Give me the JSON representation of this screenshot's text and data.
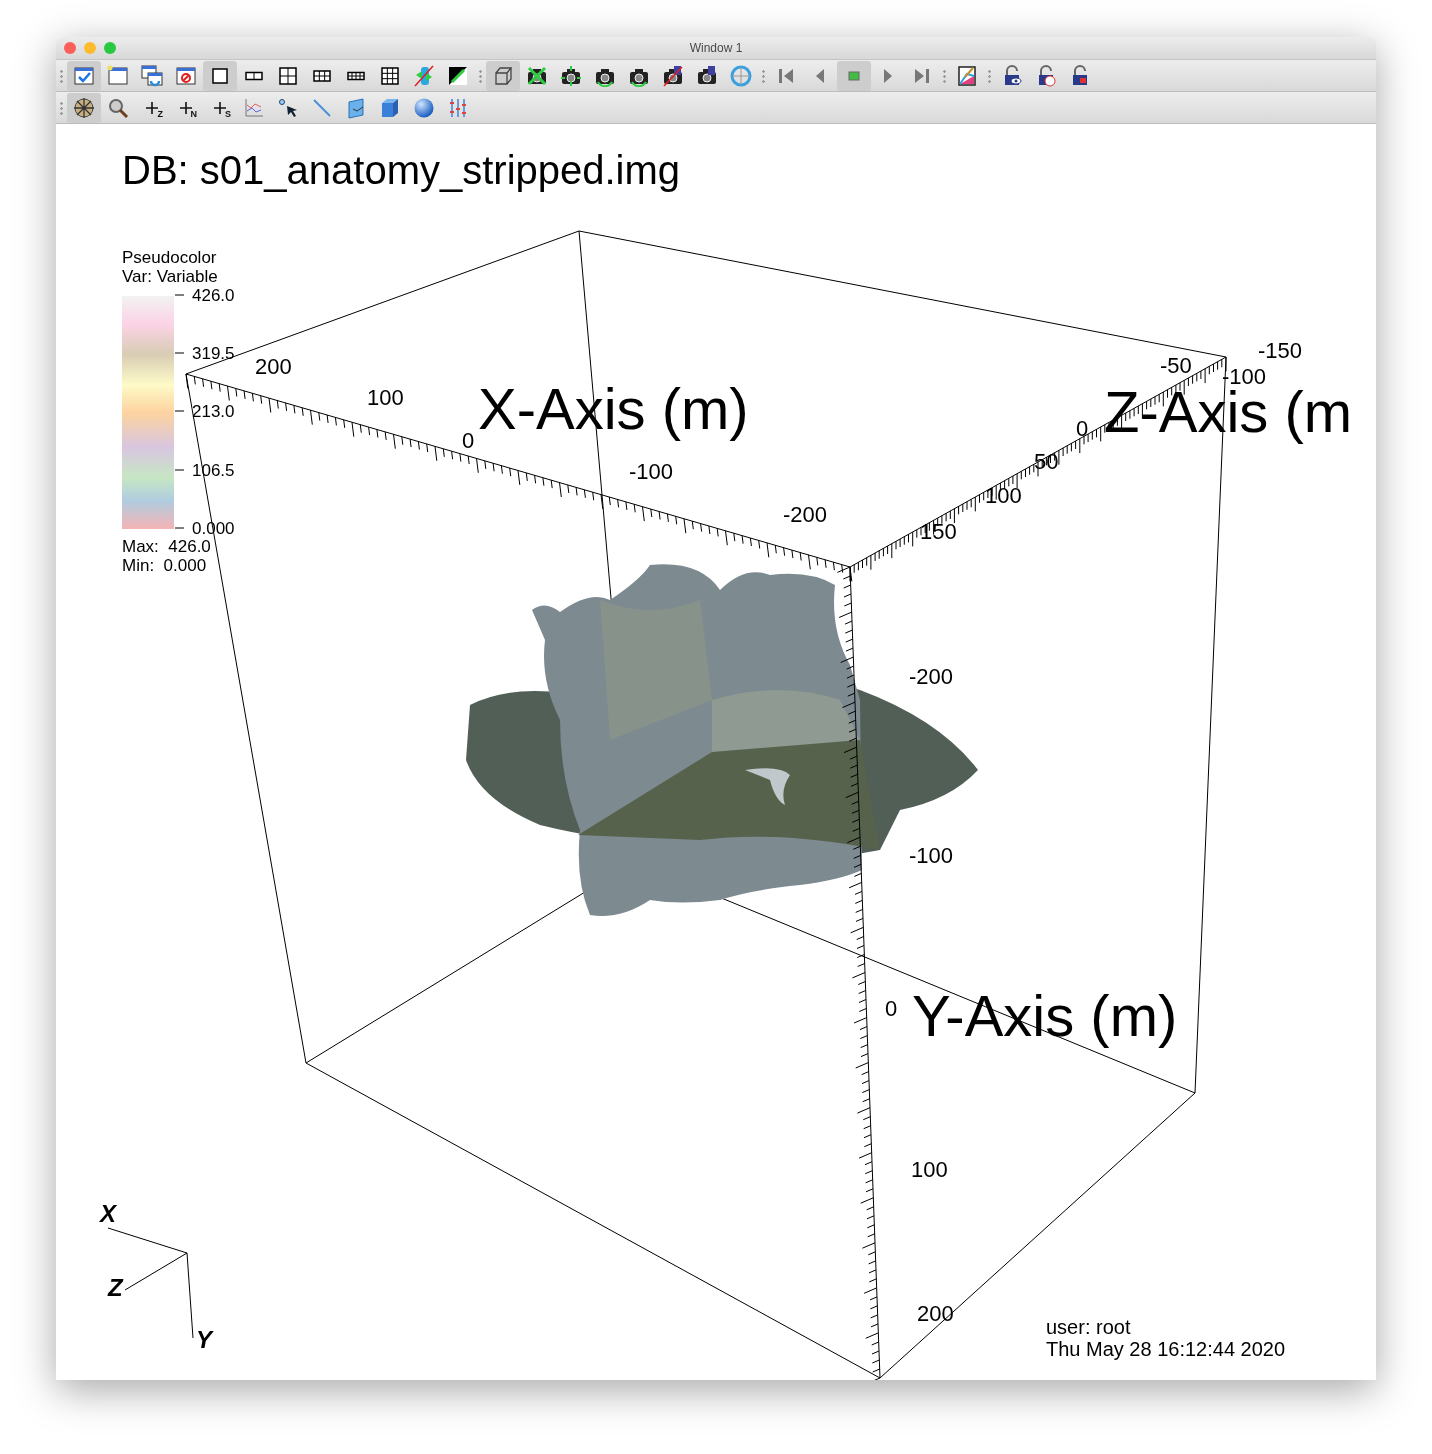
{
  "window": {
    "title": "Window 1"
  },
  "toolbar_1": {
    "groups": [
      {
        "buttons": [
          {
            "kind": "window-check",
            "selected": true
          },
          {
            "kind": "window-new",
            "selected": false
          },
          {
            "kind": "window-clone",
            "selected": false
          },
          {
            "kind": "window-delete",
            "selected": false
          },
          {
            "kind": "layout-1",
            "selected": true
          },
          {
            "kind": "layout-2",
            "selected": false
          },
          {
            "kind": "layout-4",
            "selected": false
          },
          {
            "kind": "layout-6",
            "selected": false
          },
          {
            "kind": "layout-8",
            "selected": false
          },
          {
            "kind": "layout-9",
            "selected": false
          },
          {
            "kind": "tool-crossed",
            "selected": false
          },
          {
            "kind": "invert",
            "selected": false
          }
        ]
      },
      {
        "buttons": [
          {
            "kind": "box-3d",
            "selected": true
          },
          {
            "kind": "camera-x",
            "selected": false
          },
          {
            "kind": "camera-move",
            "selected": false
          },
          {
            "kind": "camera-rotate",
            "selected": false
          },
          {
            "kind": "camera-rotate",
            "selected": false
          },
          {
            "kind": "camera-crossed",
            "selected": false
          },
          {
            "kind": "camera-save",
            "selected": false
          },
          {
            "kind": "globe",
            "selected": false
          }
        ]
      },
      {
        "buttons": [
          {
            "kind": "first",
            "selected": false
          },
          {
            "kind": "prev",
            "selected": false
          },
          {
            "kind": "stop",
            "selected": true
          },
          {
            "kind": "play",
            "selected": false
          },
          {
            "kind": "last",
            "selected": false
          }
        ]
      },
      {
        "buttons": [
          {
            "kind": "paint",
            "selected": false
          }
        ]
      },
      {
        "buttons": [
          {
            "kind": "lock-eye",
            "selected": false
          },
          {
            "kind": "lock-clock",
            "selected": false
          },
          {
            "kind": "lock-red",
            "selected": false
          }
        ]
      }
    ]
  },
  "toolbar_2": {
    "groups": [
      {
        "buttons": [
          {
            "kind": "compass",
            "selected": true
          },
          {
            "kind": "zoom",
            "selected": false
          },
          {
            "kind": "plus",
            "label": "Z",
            "selected": false
          },
          {
            "kind": "plus",
            "label": "N",
            "selected": false
          },
          {
            "kind": "plus",
            "label": "S",
            "selected": false
          },
          {
            "kind": "chart",
            "selected": false
          },
          {
            "kind": "pick",
            "selected": false
          },
          {
            "kind": "line",
            "selected": false
          },
          {
            "kind": "plane",
            "selected": false
          },
          {
            "kind": "cube",
            "selected": false
          },
          {
            "kind": "sphere",
            "selected": false
          },
          {
            "kind": "sliders",
            "selected": false
          }
        ]
      }
    ]
  },
  "plot": {
    "db_title": "DB: s01_anatomy_stripped.img",
    "legend": {
      "title": "Pseudocolor",
      "variable": "Var: Variable",
      "ticks": [
        "426.0",
        "319.5",
        "213.0",
        "106.5",
        "0.000"
      ],
      "max": "Max:  426.0",
      "min": "Min:  0.000"
    },
    "x_axis": {
      "title": "X-Axis (m)",
      "ticks": [
        "200",
        "100",
        "0",
        "-100",
        "-200"
      ]
    },
    "z_axis": {
      "title": "Z-Axis (m",
      "ticks": [
        "-150",
        "-100",
        "-50",
        "0",
        "50",
        "100",
        "150"
      ]
    },
    "y_axis": {
      "title": "Y-Axis (m)",
      "ticks": [
        "-200",
        "-100",
        "0",
        "100",
        "200"
      ]
    },
    "triad": {
      "x": "X",
      "z": "Z",
      "y": "Y"
    },
    "user": "user: root",
    "date": "Thu May 28 16:12:44 2020"
  }
}
